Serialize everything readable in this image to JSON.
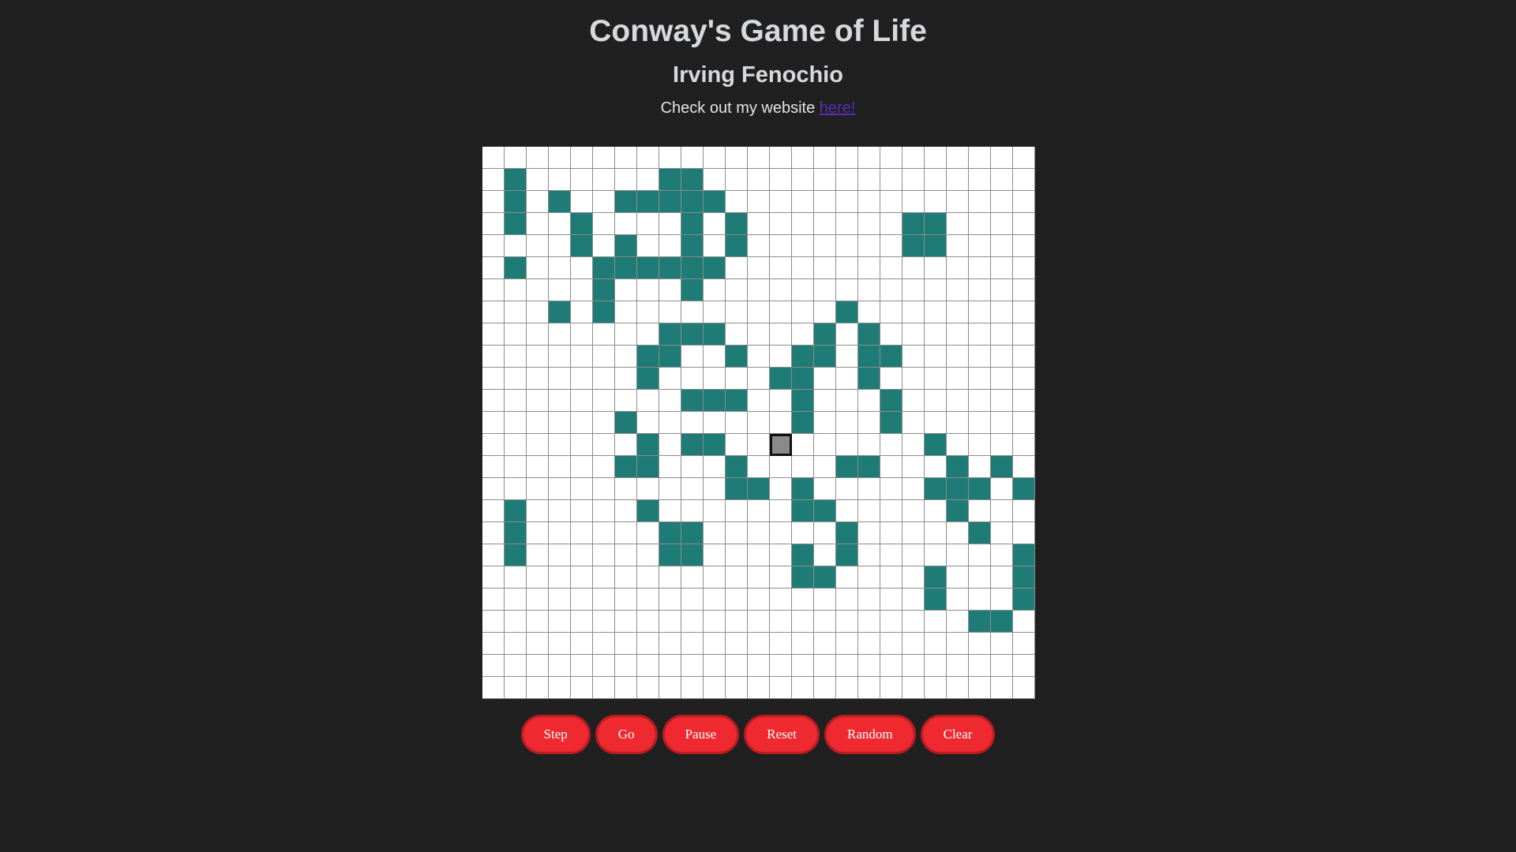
{
  "header": {
    "title": "Conway's Game of Life",
    "author": "Irving Fenochio",
    "website_text": "Check out my website ",
    "website_link": "here!"
  },
  "board": {
    "size": 25,
    "cursor": [
      13,
      13
    ],
    "alive": [
      [
        1,
        1
      ],
      [
        1,
        8
      ],
      [
        1,
        9
      ],
      [
        2,
        1
      ],
      [
        2,
        3
      ],
      [
        2,
        6
      ],
      [
        2,
        7
      ],
      [
        2,
        8
      ],
      [
        2,
        9
      ],
      [
        2,
        10
      ],
      [
        3,
        1
      ],
      [
        3,
        4
      ],
      [
        3,
        9
      ],
      [
        3,
        11
      ],
      [
        3,
        19
      ],
      [
        3,
        20
      ],
      [
        4,
        4
      ],
      [
        4,
        6
      ],
      [
        4,
        9
      ],
      [
        4,
        11
      ],
      [
        4,
        19
      ],
      [
        4,
        20
      ],
      [
        5,
        1
      ],
      [
        5,
        5
      ],
      [
        5,
        6
      ],
      [
        5,
        7
      ],
      [
        5,
        8
      ],
      [
        5,
        9
      ],
      [
        5,
        10
      ],
      [
        6,
        5
      ],
      [
        6,
        9
      ],
      [
        7,
        3
      ],
      [
        7,
        5
      ],
      [
        7,
        16
      ],
      [
        8,
        8
      ],
      [
        8,
        9
      ],
      [
        8,
        10
      ],
      [
        8,
        15
      ],
      [
        8,
        17
      ],
      [
        9,
        7
      ],
      [
        9,
        8
      ],
      [
        9,
        11
      ],
      [
        9,
        14
      ],
      [
        9,
        15
      ],
      [
        9,
        17
      ],
      [
        9,
        18
      ],
      [
        10,
        7
      ],
      [
        10,
        13
      ],
      [
        10,
        14
      ],
      [
        10,
        17
      ],
      [
        11,
        9
      ],
      [
        11,
        10
      ],
      [
        11,
        11
      ],
      [
        11,
        14
      ],
      [
        11,
        18
      ],
      [
        12,
        6
      ],
      [
        12,
        14
      ],
      [
        12,
        18
      ],
      [
        13,
        7
      ],
      [
        13,
        9
      ],
      [
        13,
        10
      ],
      [
        13,
        20
      ],
      [
        14,
        6
      ],
      [
        14,
        7
      ],
      [
        14,
        11
      ],
      [
        14,
        16
      ],
      [
        14,
        17
      ],
      [
        14,
        21
      ],
      [
        14,
        23
      ],
      [
        15,
        11
      ],
      [
        15,
        12
      ],
      [
        15,
        14
      ],
      [
        15,
        20
      ],
      [
        15,
        21
      ],
      [
        15,
        22
      ],
      [
        15,
        24
      ],
      [
        16,
        1
      ],
      [
        16,
        7
      ],
      [
        16,
        14
      ],
      [
        16,
        15
      ],
      [
        16,
        21
      ],
      [
        17,
        1
      ],
      [
        17,
        8
      ],
      [
        17,
        9
      ],
      [
        17,
        16
      ],
      [
        17,
        22
      ],
      [
        18,
        1
      ],
      [
        18,
        8
      ],
      [
        18,
        9
      ],
      [
        18,
        14
      ],
      [
        18,
        16
      ],
      [
        18,
        24
      ],
      [
        19,
        14
      ],
      [
        19,
        15
      ],
      [
        19,
        20
      ],
      [
        19,
        24
      ],
      [
        20,
        20
      ],
      [
        20,
        24
      ],
      [
        21,
        22
      ],
      [
        21,
        23
      ]
    ]
  },
  "controls": {
    "step": "Step",
    "go": "Go",
    "pause": "Pause",
    "reset": "Reset",
    "random": "Random",
    "clear": "Clear"
  },
  "colors": {
    "alive": "#1e7b75",
    "dead": "#ffffff",
    "button": "#ee2a30",
    "background": "#202020"
  }
}
